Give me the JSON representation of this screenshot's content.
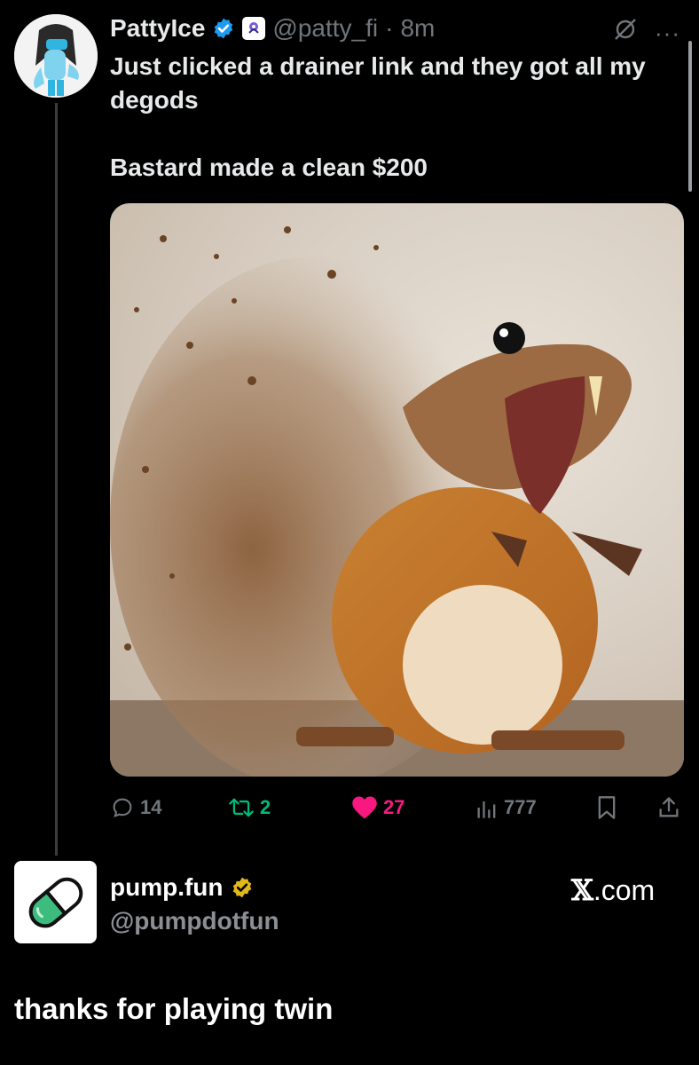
{
  "tweet": {
    "author_name": "PattyIce",
    "handle": "@patty_fi",
    "separator": "·",
    "time": "8m",
    "text_line_1": "Just clicked a drainer link and they got all my degods",
    "text_line_2": "Bastard made a clean $200",
    "media_description_icon": "squirrel-disintegrating-image",
    "actions": {
      "replies": "14",
      "reposts": "2",
      "likes": "27",
      "views": "777"
    }
  },
  "quoted_card": {
    "author_name": "pump.fun",
    "handle": "@pumpdotfun",
    "site_label_x": "𝕏",
    "site_label_rest": ".com",
    "reply_text": "thanks for playing twin"
  },
  "colors": {
    "background": "#000000",
    "text": "#e7e9ea",
    "muted": "#71767b",
    "verified_blue": "#1d9bf0",
    "verified_gold": "#e2b719",
    "repost_green": "#00ba7c",
    "like_pink": "#f91880",
    "pill_green": "#3dbd7d"
  }
}
